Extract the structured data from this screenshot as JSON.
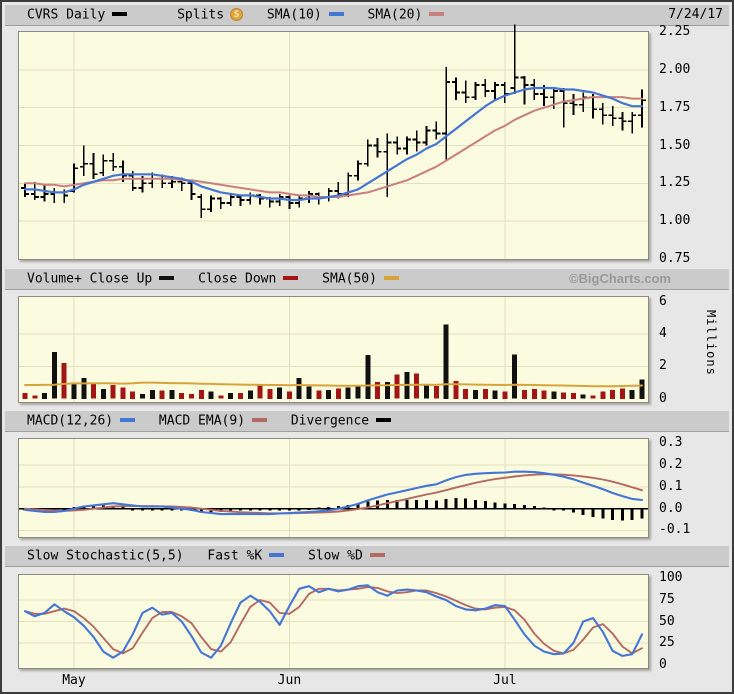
{
  "panels": {
    "price_header": {
      "symbol": "CVRS Daily",
      "splits": "Splits",
      "splits_icon": "S",
      "sma10": "SMA(10)",
      "sma20": "SMA(20)",
      "date": "7/24/17"
    },
    "volume_header": {
      "title": "Volume+ Close Up",
      "close_down": "Close Down",
      "sma50": "SMA(50)",
      "watermark": "©BigCharts.com"
    },
    "macd_header": {
      "macd": "MACD(12,26)",
      "ema": "MACD EMA(9)",
      "divergence": "Divergence"
    },
    "stoch_header": {
      "title": "Slow Stochastic(5,5)",
      "k": "Fast %K",
      "d": "Slow %D"
    }
  },
  "colors": {
    "frame_border": "#3c3c3c",
    "page_bg": "#e7e7e7",
    "header_bg": "#cbcbcb",
    "plot_bg": "#fbfbdf",
    "grid": "#e1e1bd",
    "black": "#000000",
    "volume_up": "#111111",
    "volume_down": "#a31515",
    "sma10_blue": "#4575d5",
    "sma20_red": "#c97f7f",
    "sma50_gold": "#d9a33c",
    "macd_blue": "#4575d5",
    "signal_red": "#b46a62",
    "stoch_k_blue": "#4575d5",
    "stoch_d_red": "#b46a62",
    "watermark_gray": "#9a9a9a",
    "coin_gold": "#e2a43c"
  },
  "x_axis": {
    "labels": [
      "May",
      "Jun",
      "Jul"
    ],
    "indices": [
      5,
      27,
      49
    ]
  },
  "chart_data": [
    {
      "type": "ohlc",
      "title": "CVRS Daily price with SMA(10) and SMA(20)",
      "date_range": "late Apr 2017 to 7/24/17",
      "ylim": [
        0.75,
        2.25
      ],
      "yticks": [
        2.25,
        2.0,
        1.75,
        1.5,
        1.25,
        1.0,
        0.75
      ],
      "ytick_labels": [
        "2.25",
        "2.00",
        "1.75",
        "1.50",
        "1.25",
        "1.00",
        "0.75"
      ],
      "ohlc": [
        [
          1.22,
          1.25,
          1.16,
          1.18
        ],
        [
          1.18,
          1.26,
          1.14,
          1.16
        ],
        [
          1.16,
          1.24,
          1.13,
          1.18
        ],
        [
          1.18,
          1.22,
          1.12,
          1.19
        ],
        [
          1.19,
          1.21,
          1.12,
          1.17
        ],
        [
          1.2,
          1.38,
          1.19,
          1.35
        ],
        [
          1.36,
          1.5,
          1.3,
          1.38
        ],
        [
          1.38,
          1.45,
          1.28,
          1.31
        ],
        [
          1.32,
          1.44,
          1.3,
          1.4
        ],
        [
          1.4,
          1.45,
          1.33,
          1.36
        ],
        [
          1.36,
          1.4,
          1.26,
          1.3
        ],
        [
          1.3,
          1.33,
          1.2,
          1.22
        ],
        [
          1.22,
          1.3,
          1.19,
          1.25
        ],
        [
          1.25,
          1.32,
          1.22,
          1.28
        ],
        [
          1.28,
          1.31,
          1.22,
          1.25
        ],
        [
          1.25,
          1.3,
          1.22,
          1.26
        ],
        [
          1.26,
          1.29,
          1.2,
          1.25
        ],
        [
          1.25,
          1.26,
          1.14,
          1.18
        ],
        [
          1.16,
          1.18,
          1.02,
          1.08
        ],
        [
          1.08,
          1.17,
          1.06,
          1.15
        ],
        [
          1.15,
          1.16,
          1.08,
          1.12
        ],
        [
          1.12,
          1.18,
          1.1,
          1.16
        ],
        [
          1.16,
          1.17,
          1.1,
          1.14
        ],
        [
          1.14,
          1.19,
          1.11,
          1.17
        ],
        [
          1.17,
          1.18,
          1.11,
          1.15
        ],
        [
          1.15,
          1.16,
          1.09,
          1.13
        ],
        [
          1.13,
          1.18,
          1.1,
          1.16
        ],
        [
          1.16,
          1.17,
          1.08,
          1.12
        ],
        [
          1.12,
          1.17,
          1.09,
          1.15
        ],
        [
          1.15,
          1.2,
          1.12,
          1.18
        ],
        [
          1.18,
          1.19,
          1.11,
          1.16
        ],
        [
          1.16,
          1.22,
          1.13,
          1.2
        ],
        [
          1.2,
          1.26,
          1.15,
          1.18
        ],
        [
          1.18,
          1.32,
          1.16,
          1.3
        ],
        [
          1.3,
          1.4,
          1.27,
          1.38
        ],
        [
          1.38,
          1.54,
          1.36,
          1.5
        ],
        [
          1.5,
          1.55,
          1.42,
          1.46
        ],
        [
          1.46,
          1.58,
          1.16,
          1.52
        ],
        [
          1.52,
          1.56,
          1.44,
          1.48
        ],
        [
          1.48,
          1.56,
          1.44,
          1.54
        ],
        [
          1.54,
          1.6,
          1.46,
          1.52
        ],
        [
          1.52,
          1.63,
          1.5,
          1.6
        ],
        [
          1.6,
          1.66,
          1.54,
          1.58
        ],
        [
          1.58,
          2.02,
          1.4,
          1.92
        ],
        [
          1.92,
          1.95,
          1.8,
          1.85
        ],
        [
          1.85,
          1.93,
          1.78,
          1.82
        ],
        [
          1.82,
          1.92,
          1.8,
          1.9
        ],
        [
          1.9,
          1.94,
          1.82,
          1.86
        ],
        [
          1.86,
          1.92,
          1.8,
          1.9
        ],
        [
          1.9,
          1.92,
          1.78,
          1.84
        ],
        [
          1.88,
          2.3,
          1.84,
          1.95
        ],
        [
          1.95,
          1.96,
          1.77,
          1.9
        ],
        [
          1.9,
          1.94,
          1.8,
          1.84
        ],
        [
          1.84,
          1.9,
          1.76,
          1.82
        ],
        [
          1.82,
          1.88,
          1.74,
          1.86
        ],
        [
          1.86,
          1.88,
          1.62,
          1.78
        ],
        [
          1.78,
          1.84,
          1.7,
          1.77
        ],
        [
          1.77,
          1.85,
          1.72,
          1.82
        ],
        [
          1.82,
          1.84,
          1.68,
          1.74
        ],
        [
          1.74,
          1.78,
          1.64,
          1.7
        ],
        [
          1.7,
          1.76,
          1.63,
          1.68
        ],
        [
          1.68,
          1.72,
          1.6,
          1.66
        ],
        [
          1.66,
          1.72,
          1.58,
          1.7
        ],
        [
          1.7,
          1.87,
          1.62,
          1.8
        ]
      ],
      "series": [
        {
          "name": "SMA(10)",
          "color": "#4575d5",
          "values": [
            1.21,
            1.21,
            1.2,
            1.19,
            1.19,
            1.21,
            1.24,
            1.26,
            1.28,
            1.3,
            1.31,
            1.31,
            1.31,
            1.31,
            1.3,
            1.29,
            1.28,
            1.26,
            1.23,
            1.21,
            1.19,
            1.18,
            1.17,
            1.17,
            1.16,
            1.15,
            1.15,
            1.14,
            1.14,
            1.15,
            1.15,
            1.16,
            1.17,
            1.19,
            1.21,
            1.25,
            1.29,
            1.33,
            1.37,
            1.41,
            1.44,
            1.48,
            1.51,
            1.56,
            1.61,
            1.66,
            1.71,
            1.76,
            1.8,
            1.83,
            1.85,
            1.87,
            1.88,
            1.88,
            1.88,
            1.87,
            1.87,
            1.86,
            1.85,
            1.83,
            1.81,
            1.78,
            1.76,
            1.76
          ]
        },
        {
          "name": "SMA(20)",
          "color": "#c97f7f",
          "values": [
            1.25,
            1.25,
            1.24,
            1.24,
            1.23,
            1.24,
            1.25,
            1.26,
            1.27,
            1.27,
            1.28,
            1.28,
            1.28,
            1.28,
            1.28,
            1.28,
            1.27,
            1.27,
            1.26,
            1.25,
            1.24,
            1.23,
            1.22,
            1.21,
            1.2,
            1.19,
            1.19,
            1.18,
            1.17,
            1.17,
            1.16,
            1.16,
            1.16,
            1.17,
            1.18,
            1.19,
            1.21,
            1.23,
            1.25,
            1.27,
            1.3,
            1.33,
            1.36,
            1.4,
            1.44,
            1.48,
            1.52,
            1.56,
            1.6,
            1.63,
            1.67,
            1.7,
            1.73,
            1.75,
            1.77,
            1.79,
            1.8,
            1.81,
            1.82,
            1.82,
            1.82,
            1.82,
            1.81,
            1.81
          ]
        }
      ]
    },
    {
      "type": "bar",
      "title": "Volume with up/down coloring and SMA(50)",
      "ylabel": "Millions",
      "ylim": [
        -0.2,
        6.3
      ],
      "yticks": [
        6,
        4,
        2,
        0
      ],
      "ytick_labels": [
        "6",
        "4",
        "2",
        "0"
      ],
      "values": [
        0.35,
        0.2,
        0.35,
        2.9,
        2.2,
        1.0,
        1.3,
        0.9,
        0.6,
        0.85,
        0.7,
        0.45,
        0.3,
        0.55,
        0.5,
        0.55,
        0.35,
        0.3,
        0.55,
        0.45,
        0.2,
        0.35,
        0.35,
        0.5,
        0.85,
        0.6,
        0.7,
        0.45,
        1.3,
        0.75,
        0.5,
        0.55,
        0.65,
        0.7,
        0.8,
        2.7,
        1.05,
        1.05,
        1.5,
        1.65,
        1.55,
        0.85,
        0.8,
        4.6,
        1.1,
        0.6,
        0.55,
        0.6,
        0.5,
        0.45,
        2.75,
        0.55,
        0.6,
        0.5,
        0.45,
        0.4,
        0.35,
        0.25,
        0.2,
        0.45,
        0.55,
        0.65,
        0.55,
        1.2
      ],
      "direction": "DDUUDUUDUDDDUUDUDDDUDUDUDDUDUUDUDUUUDUDUDUDUDDUDUDUDDDUDDUDDDDUU",
      "series": [
        {
          "name": "SMA(50)",
          "color": "#d9a33c",
          "values": [
            0.85,
            0.85,
            0.86,
            0.87,
            0.92,
            0.95,
            0.95,
            0.96,
            0.96,
            0.95,
            0.94,
            0.96,
            1.0,
            1.0,
            0.98,
            0.97,
            0.96,
            0.95,
            0.93,
            0.92,
            0.9,
            0.89,
            0.88,
            0.87,
            0.86,
            0.85,
            0.85,
            0.84,
            0.85,
            0.84,
            0.83,
            0.82,
            0.81,
            0.8,
            0.8,
            0.82,
            0.83,
            0.84,
            0.85,
            0.86,
            0.87,
            0.87,
            0.86,
            0.9,
            0.9,
            0.89,
            0.88,
            0.87,
            0.86,
            0.85,
            0.87,
            0.86,
            0.85,
            0.84,
            0.83,
            0.82,
            0.8,
            0.79,
            0.78,
            0.78,
            0.78,
            0.79,
            0.8,
            0.82
          ]
        }
      ]
    },
    {
      "type": "line+bar",
      "title": "MACD(12,26) with MACD EMA(9) and Divergence histogram",
      "ylim": [
        -0.13,
        0.32
      ],
      "yticks": [
        0.3,
        0.2,
        0.1,
        0.0,
        -0.1
      ],
      "ytick_labels": [
        "0.3",
        "0.2",
        "0.1",
        "0.0",
        "-0.1"
      ],
      "series": [
        {
          "name": "MACD(12,26)",
          "color": "#4575d5",
          "values": [
            -0.005,
            -0.01,
            -0.015,
            -0.015,
            -0.01,
            0.0,
            0.01,
            0.015,
            0.02,
            0.025,
            0.02,
            0.015,
            0.01,
            0.01,
            0.01,
            0.005,
            0.0,
            -0.005,
            -0.015,
            -0.02,
            -0.025,
            -0.025,
            -0.025,
            -0.025,
            -0.025,
            -0.025,
            -0.022,
            -0.02,
            -0.018,
            -0.015,
            -0.012,
            -0.008,
            0.0,
            0.01,
            0.022,
            0.038,
            0.052,
            0.065,
            0.075,
            0.085,
            0.095,
            0.105,
            0.112,
            0.13,
            0.145,
            0.155,
            0.16,
            0.163,
            0.165,
            0.166,
            0.17,
            0.17,
            0.168,
            0.163,
            0.156,
            0.147,
            0.135,
            0.12,
            0.105,
            0.09,
            0.072,
            0.058,
            0.045,
            0.04
          ]
        },
        {
          "name": "MACD EMA(9)",
          "color": "#b46a62",
          "values": [
            0.0,
            -0.003,
            -0.006,
            -0.008,
            -0.01,
            -0.008,
            -0.005,
            0.0,
            0.005,
            0.01,
            0.012,
            0.013,
            0.012,
            0.012,
            0.011,
            0.01,
            0.008,
            0.005,
            0.0,
            -0.005,
            -0.01,
            -0.013,
            -0.016,
            -0.018,
            -0.02,
            -0.021,
            -0.021,
            -0.021,
            -0.02,
            -0.019,
            -0.018,
            -0.016,
            -0.013,
            -0.008,
            -0.002,
            0.006,
            0.015,
            0.025,
            0.035,
            0.045,
            0.055,
            0.065,
            0.074,
            0.085,
            0.097,
            0.108,
            0.119,
            0.128,
            0.136,
            0.142,
            0.148,
            0.153,
            0.156,
            0.158,
            0.158,
            0.156,
            0.153,
            0.148,
            0.142,
            0.134,
            0.124,
            0.112,
            0.098,
            0.085
          ]
        },
        {
          "name": "Divergence",
          "color": "#000000",
          "render": "bar",
          "values": [
            -0.005,
            -0.007,
            -0.009,
            -0.007,
            0.0,
            0.008,
            0.015,
            0.015,
            0.015,
            0.015,
            0.008,
            0.002,
            -0.002,
            -0.002,
            -0.001,
            -0.005,
            -0.008,
            -0.01,
            -0.015,
            -0.015,
            -0.015,
            -0.012,
            -0.009,
            -0.007,
            -0.005,
            -0.004,
            -0.001,
            0.001,
            0.002,
            0.004,
            0.006,
            0.008,
            0.013,
            0.018,
            0.024,
            0.032,
            0.037,
            0.04,
            0.04,
            0.04,
            0.04,
            0.04,
            0.038,
            0.045,
            0.048,
            0.047,
            0.041,
            0.035,
            0.029,
            0.024,
            0.022,
            0.017,
            0.012,
            0.005,
            -0.002,
            -0.009,
            -0.018,
            -0.028,
            -0.037,
            -0.044,
            -0.052,
            -0.054,
            -0.053,
            -0.045
          ]
        }
      ]
    },
    {
      "type": "line",
      "title": "Slow Stochastic(5,5): Fast %K and Slow %D",
      "ylim": [
        -4,
        104
      ],
      "yticks": [
        100,
        75,
        50,
        25,
        0
      ],
      "ytick_labels": [
        "100",
        "75",
        "50",
        "25",
        "0"
      ],
      "series": [
        {
          "name": "Fast %K",
          "color": "#4575d5",
          "values": [
            62,
            56,
            60,
            70,
            62,
            55,
            45,
            32,
            15,
            8,
            15,
            35,
            60,
            66,
            58,
            60,
            50,
            33,
            14,
            8,
            22,
            48,
            72,
            80,
            73,
            62,
            46,
            68,
            88,
            91,
            84,
            88,
            85,
            87,
            91,
            92,
            84,
            80,
            86,
            87,
            86,
            84,
            79,
            75,
            68,
            64,
            63,
            65,
            69,
            68,
            52,
            35,
            22,
            15,
            12,
            13,
            25,
            50,
            54,
            38,
            16,
            10,
            12,
            35
          ]
        },
        {
          "name": "Slow %D",
          "color": "#b46a62",
          "values": [
            62,
            59,
            59,
            62,
            65,
            62,
            54,
            44,
            31,
            18,
            13,
            19,
            37,
            54,
            61,
            61,
            56,
            48,
            32,
            18,
            15,
            26,
            47,
            67,
            75,
            72,
            60,
            59,
            67,
            82,
            88,
            88,
            86,
            87,
            88,
            90,
            89,
            85,
            83,
            84,
            86,
            86,
            83,
            79,
            74,
            69,
            65,
            64,
            66,
            67,
            63,
            52,
            36,
            24,
            16,
            13,
            17,
            29,
            43,
            47,
            36,
            21,
            13,
            19
          ]
        }
      ]
    }
  ]
}
